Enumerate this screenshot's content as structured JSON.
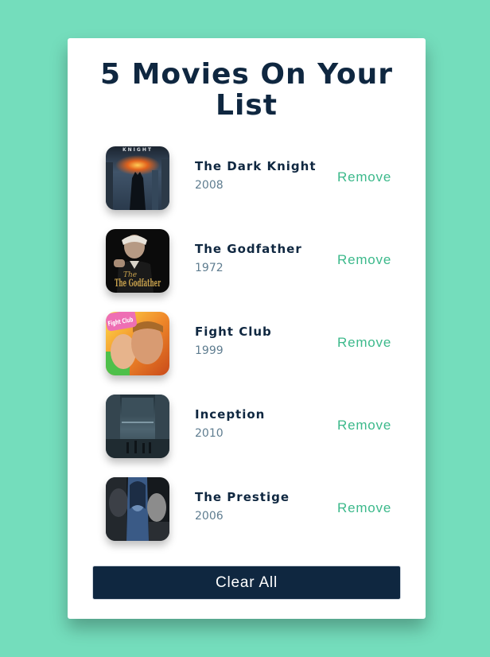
{
  "page": {
    "background_color": "#74ddbc",
    "card_color": "#ffffff",
    "accent_color": "#3cb98b",
    "title_color": "#0f2740"
  },
  "header": {
    "title": "5 Movies On Your List"
  },
  "movies": [
    {
      "title": "The Dark Knight",
      "year": "2008",
      "poster_text": "KNIGHT",
      "remove_label": "Remove"
    },
    {
      "title": "The Godfather",
      "year": "1972",
      "poster_text": "The Godfather",
      "remove_label": "Remove"
    },
    {
      "title": "Fight Club",
      "year": "1999",
      "poster_text": "Fight Club",
      "remove_label": "Remove"
    },
    {
      "title": "Inception",
      "year": "2010",
      "poster_text": "",
      "remove_label": "Remove"
    },
    {
      "title": "The Prestige",
      "year": "2006",
      "poster_text": "",
      "remove_label": "Remove"
    }
  ],
  "footer": {
    "clear_label": "Clear All"
  }
}
